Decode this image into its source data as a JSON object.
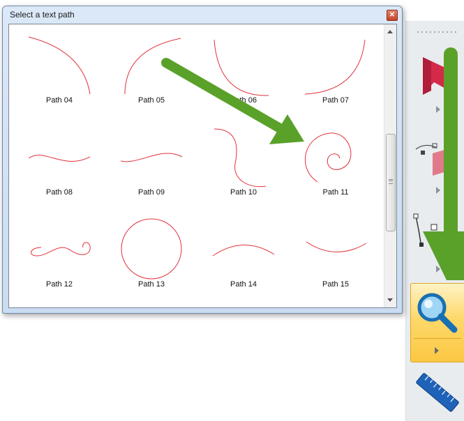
{
  "dialog": {
    "title": "Select a text path",
    "close_glyph": "✕"
  },
  "paths": [
    {
      "label": "Path 04"
    },
    {
      "label": "Path 05"
    },
    {
      "label": "Path 06"
    },
    {
      "label": "Path 07"
    },
    {
      "label": "Path 08"
    },
    {
      "label": "Path 09"
    },
    {
      "label": "Path 10"
    },
    {
      "label": "Path 11"
    },
    {
      "label": "Path 12"
    },
    {
      "label": "Path 13"
    },
    {
      "label": "Path 14"
    },
    {
      "label": "Path 15"
    }
  ],
  "colors": {
    "path_stroke": "#e0303a",
    "annotation_arrow": "#5aa12a",
    "zoom_button_fill": "#fcd55a",
    "toolbar_bg": "#e9ecef"
  },
  "toolbar": {
    "icons": [
      "flag-icon",
      "text-path-tool-icon",
      "node-edit-tool-icon",
      "zoom-tool-icon",
      "measure-ruler-icon"
    ]
  }
}
